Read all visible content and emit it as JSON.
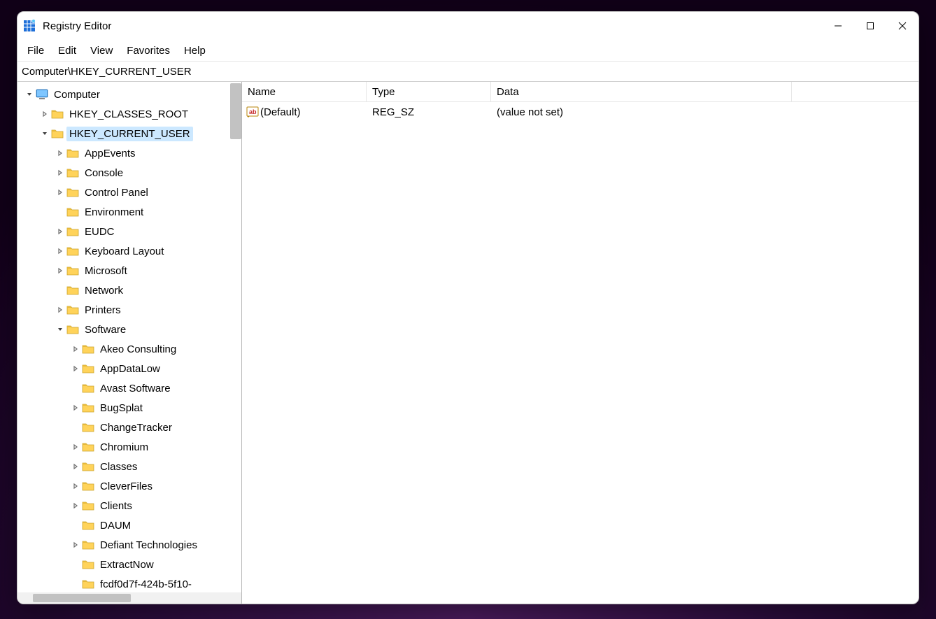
{
  "window": {
    "title": "Registry Editor"
  },
  "menu": [
    "File",
    "Edit",
    "View",
    "Favorites",
    "Help"
  ],
  "address": "Computer\\HKEY_CURRENT_USER",
  "tree": {
    "root": "Computer",
    "hives": [
      {
        "label": "HKEY_CLASSES_ROOT",
        "expandable": true,
        "expanded": false,
        "selected": false
      },
      {
        "label": "HKEY_CURRENT_USER",
        "expandable": true,
        "expanded": true,
        "selected": true,
        "children": [
          {
            "label": "AppEvents",
            "expandable": true,
            "expanded": false
          },
          {
            "label": "Console",
            "expandable": true,
            "expanded": false
          },
          {
            "label": "Control Panel",
            "expandable": true,
            "expanded": false
          },
          {
            "label": "Environment",
            "expandable": false,
            "expanded": false
          },
          {
            "label": "EUDC",
            "expandable": true,
            "expanded": false
          },
          {
            "label": "Keyboard Layout",
            "expandable": true,
            "expanded": false
          },
          {
            "label": "Microsoft",
            "expandable": true,
            "expanded": false
          },
          {
            "label": "Network",
            "expandable": false,
            "expanded": false
          },
          {
            "label": "Printers",
            "expandable": true,
            "expanded": false
          },
          {
            "label": "Software",
            "expandable": true,
            "expanded": true,
            "children": [
              {
                "label": "Akeo Consulting",
                "expandable": true,
                "expanded": false
              },
              {
                "label": "AppDataLow",
                "expandable": true,
                "expanded": false
              },
              {
                "label": "Avast Software",
                "expandable": false,
                "expanded": false
              },
              {
                "label": "BugSplat",
                "expandable": true,
                "expanded": false
              },
              {
                "label": "ChangeTracker",
                "expandable": false,
                "expanded": false
              },
              {
                "label": "Chromium",
                "expandable": true,
                "expanded": false
              },
              {
                "label": "Classes",
                "expandable": true,
                "expanded": false
              },
              {
                "label": "CleverFiles",
                "expandable": true,
                "expanded": false
              },
              {
                "label": "Clients",
                "expandable": true,
                "expanded": false
              },
              {
                "label": "DAUM",
                "expandable": false,
                "expanded": false
              },
              {
                "label": "Defiant Technologies",
                "expandable": true,
                "expanded": false
              },
              {
                "label": "ExtractNow",
                "expandable": false,
                "expanded": false
              },
              {
                "label": "fcdf0d7f-424b-5f10-",
                "expandable": false,
                "expanded": false
              }
            ]
          }
        ]
      }
    ]
  },
  "list": {
    "columns": [
      "Name",
      "Type",
      "Data"
    ],
    "rows": [
      {
        "name": "(Default)",
        "type": "REG_SZ",
        "data": "(value not set)"
      }
    ]
  }
}
